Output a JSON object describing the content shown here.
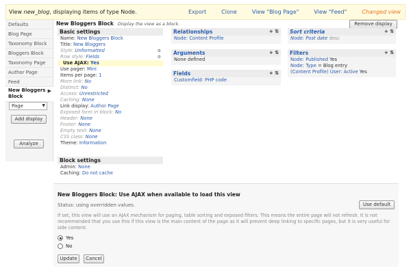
{
  "header": {
    "title_prefix": "View ",
    "view_name": "new_blog",
    "title_suffix": ", displaying items of type Node.",
    "actions": [
      "Export",
      "Clone",
      "View \"Blog Page\"",
      "View \"Feed\""
    ],
    "changed": "Changed view"
  },
  "tabs": {
    "items": [
      "Defaults",
      "Blog Page",
      "Taxonomy Block",
      "Bloggers Block",
      "Taxonomy Page",
      "Author Page",
      "Feed"
    ],
    "active": "New Bloggers Block",
    "select_value": "Page",
    "add_display": "Add display",
    "analyze": "Analyze"
  },
  "display": {
    "title": "New Bloggers Block",
    "subtitle": "Display the view as a block.",
    "remove": "Remove display"
  },
  "basic": {
    "heading": "Basic settings",
    "rows": [
      {
        "label": "Name: ",
        "value": "New Bloggers Block",
        "muted": false
      },
      {
        "label": "Title: ",
        "value": "New Bloggers",
        "muted": false
      },
      {
        "label": "Style: ",
        "value": "Unformatted",
        "muted": true
      },
      {
        "label": "Row style: ",
        "value": "Fields",
        "muted": true
      },
      {
        "label": "Use AJAX: ",
        "value": "Yes",
        "muted": false,
        "hl": true
      },
      {
        "label": "Use pager: ",
        "value": "Mini",
        "muted": false
      },
      {
        "label": "Items per page: ",
        "value": "1",
        "muted": false
      },
      {
        "label": "More link: ",
        "value": "No",
        "muted": true
      },
      {
        "label": "Distinct: ",
        "value": "No",
        "muted": true
      },
      {
        "label": "Access: ",
        "value": "Unrestricted",
        "muted": true
      },
      {
        "label": "Caching: ",
        "value": "None",
        "muted": true
      },
      {
        "label": "Link display: ",
        "value": "Author Page",
        "muted": false
      },
      {
        "label": "Exposed form in block: ",
        "value": "No",
        "muted": true
      },
      {
        "label": "Header: ",
        "value": "None",
        "muted": true
      },
      {
        "label": "Footer: ",
        "value": "None",
        "muted": true
      },
      {
        "label": "Empty text: ",
        "value": "None",
        "muted": true
      },
      {
        "label": "CSS class: ",
        "value": "None",
        "muted": true
      },
      {
        "label": "Theme: ",
        "value": "Information",
        "muted": false
      }
    ]
  },
  "block_settings": {
    "heading": "Block settings",
    "rows": [
      {
        "label": "Admin: ",
        "value": "None"
      },
      {
        "label": "Caching: ",
        "value": "Do not cache"
      }
    ]
  },
  "relationships": {
    "heading": "Relationships",
    "value": "Node: Content Profile"
  },
  "arguments": {
    "heading": "Arguments",
    "value": "None defined"
  },
  "fields": {
    "heading": "Fields",
    "value": "Customfield: PHP code"
  },
  "sort": {
    "heading": "Sort criteria",
    "value": "Node: Post date",
    "suffix": "desc"
  },
  "filters": {
    "heading": "Filters",
    "rows": [
      {
        "label": "Node: Published",
        "value": " Yes"
      },
      {
        "label": "Node: Type",
        "value": " = Blog entry"
      },
      {
        "label": "(Content Profile) User: Active",
        "value": " Yes"
      }
    ]
  },
  "ajax_form": {
    "title": "New Bloggers Block: Use AJAX when available to load this view",
    "status": "Status: using overridden values.",
    "use_default": "Use default",
    "help": "If set, this view will use an AJAX mechanism for paging, table sorting and exposed filters. This means the entire page will not refresh. It is not recommended that you use this if this view is the main content of the page as it will prevent deep linking to specific pages, but it is very useful for side content.",
    "options": [
      "Yes",
      "No"
    ],
    "selected": "Yes",
    "update": "Update",
    "cancel": "Cancel"
  }
}
